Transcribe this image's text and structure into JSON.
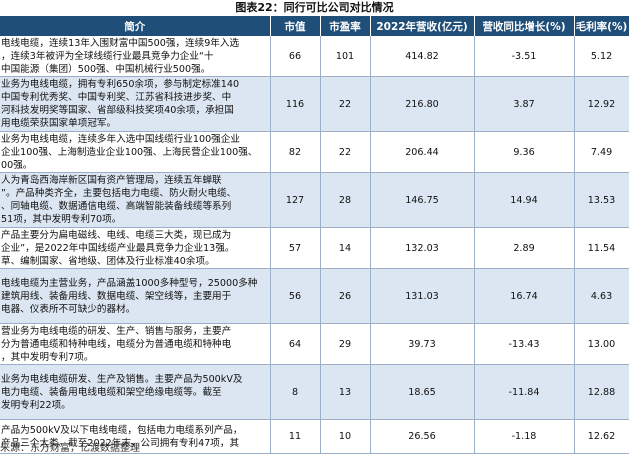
{
  "title": "图表22：同行可比公司对比情况",
  "headers": [
    "简介",
    "市值",
    "市盈率",
    "2022年营收(亿元)",
    "营收同比增长(%)",
    "毛利率(%)"
  ],
  "rows": [
    {
      "intro": [
        "电线电缆，连续13年入围财富中国500强，连续9年入选",
        "，连续3年被评为全球线缆行业最具竞争力企业“十",
        "中国能源（集团）500强、中国机械行业500强。"
      ],
      "cap": "66",
      "pe": "101",
      "rev": "414.82",
      "growth": "-3.51",
      "margin": "5.12"
    },
    {
      "intro": [
        "业务为电线电缆，拥有专利650余项，参与制定标准140",
        "中国专利优秀奖、中国专利奖、江苏省科技进步奖、中",
        "河科技发明奖等国家、省部级科技奖项40余项，承担国",
        "用电缆荣获国家单项冠军。"
      ],
      "cap": "116",
      "pe": "22",
      "rev": "216.80",
      "growth": "3.87",
      "margin": "12.92"
    },
    {
      "intro": [
        "业务为电线电缆，连续多年入选中国线缆行业100强企业",
        "企业100强、上海制造业企业100强、上海民营企业100强、",
        "00强。"
      ],
      "cap": "82",
      "pe": "22",
      "rev": "206.44",
      "growth": "9.36",
      "margin": "7.49"
    },
    {
      "intro": [
        "人为青岛西海岸新区国有资产管理局，连续五年蝉联",
        "”。产品种类齐全，主要包括电力电缆、防火耐火电缆、",
        "、同轴电缆、数据通信电缆、高端智能装备线缆等系列",
        "51项，其中发明专利70项。"
      ],
      "cap": "127",
      "pe": "28",
      "rev": "146.75",
      "growth": "14.94",
      "margin": "13.53"
    },
    {
      "intro": [
        "产品主要分为扁电磁线、电线、电缆三大类，现已成为",
        "企业”，是2022年中国线缆产业最具竞争力企业13强。",
        "草、编制国家、省地级、团体及行业标准40余项。"
      ],
      "cap": "57",
      "pe": "14",
      "rev": "132.03",
      "growth": "2.89",
      "margin": "11.54"
    },
    {
      "intro": [
        "电线电缆为主营业务，产品涵盖1000多种型号，25000多种",
        "建筑用线、装备用线、数据电缆、架空线等，主要用于",
        "电器、仪表所不可缺少的器材。"
      ],
      "cap": "56",
      "pe": "26",
      "rev": "131.03",
      "growth": "16.74",
      "margin": "4.63"
    },
    {
      "intro": [
        "营业务为电线电缆的研发、生产、销售与服务，主要产",
        "分为普通电缆和特种电线，电缆分为普通电缆和特种电",
        "，其中发明专利7项。"
      ],
      "cap": "64",
      "pe": "29",
      "rev": "39.73",
      "growth": "-13.43",
      "margin": "13.00"
    },
    {
      "intro": [
        "业务为电线电缆研发、生产及销售。主要产品为500kV及",
        "电力电缆、装备用电线电缆和架空绝缘电缆等。截至",
        "发明专利22项。"
      ],
      "cap": "8",
      "pe": "13",
      "rev": "18.65",
      "growth": "-11.84",
      "margin": "12.88"
    },
    {
      "intro": [
        "产品为500kV及以下电线电缆，包括电力电缆系列产品，",
        "产品三个大类。截至2022年末，公司拥有专利47项，其"
      ],
      "cap": "11",
      "pe": "10",
      "rev": "26.56",
      "growth": "-1.18",
      "margin": "12.62"
    }
  ],
  "source": "来源：东方财富，亿渡数据整理"
}
